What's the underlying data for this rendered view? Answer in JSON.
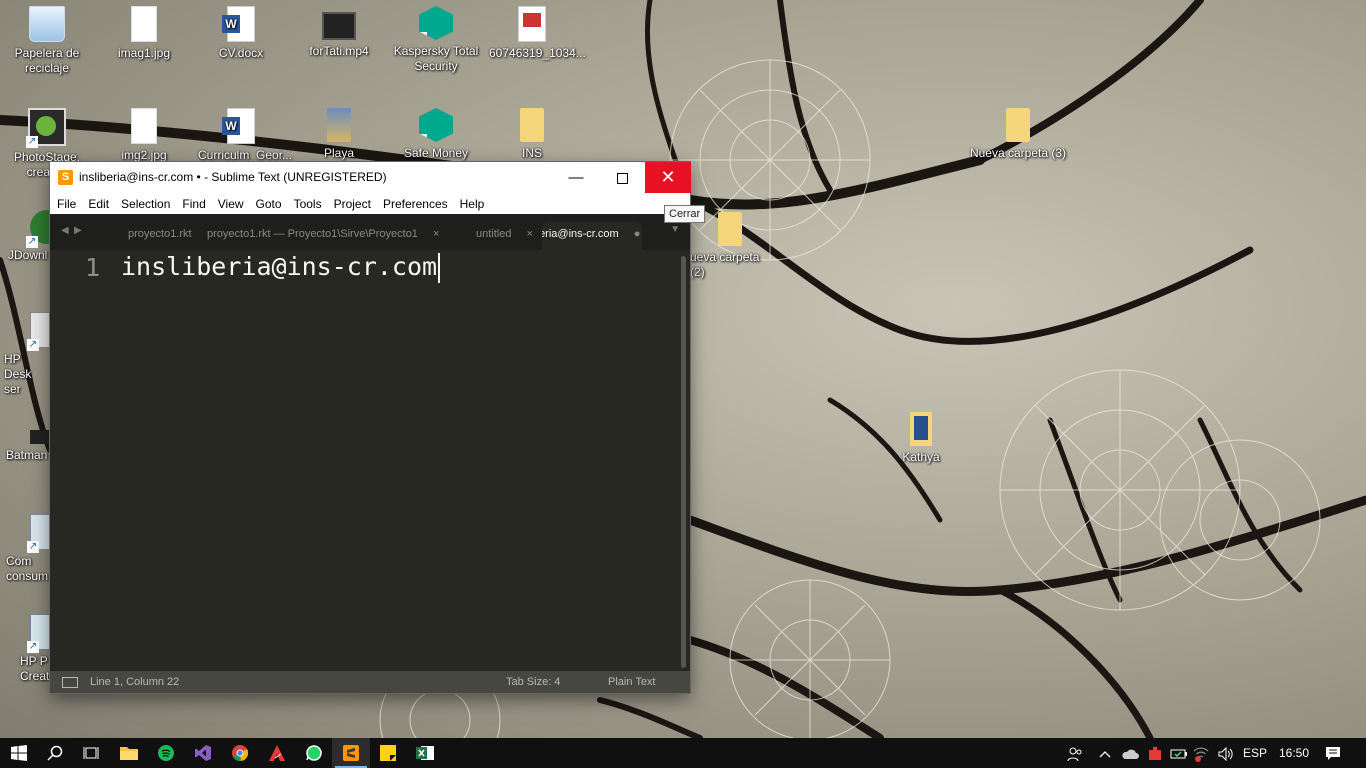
{
  "desktop": {
    "icons": [
      {
        "label": "Papelera de reciclaje"
      },
      {
        "label": "imag1.jpg"
      },
      {
        "label": "CV.docx"
      },
      {
        "label": "forTati.mp4"
      },
      {
        "label": "Kaspersky Total Security"
      },
      {
        "label": "60746319_1034..."
      },
      {
        "label": "PhotoStage, creador"
      },
      {
        "label": "img2.jpg"
      },
      {
        "label": "Curriculm_Geor..."
      },
      {
        "label": "Playa"
      },
      {
        "label": "Safe Money"
      },
      {
        "label": "INS"
      },
      {
        "label": "Nueva carpeta (3)"
      },
      {
        "label": "ueva carpeta (2)"
      },
      {
        "label": "JDownl"
      },
      {
        "label": "HP Desk ser"
      },
      {
        "label": "Batman"
      },
      {
        "label": "Com consum"
      },
      {
        "label": "HP P Creat"
      },
      {
        "label": "Kathya"
      }
    ]
  },
  "window": {
    "title": "insliberia@ins-cr.com • - Sublime Text (UNREGISTERED)",
    "app_icon_letter": "S",
    "close_glyph": "✕",
    "min_glyph": "—",
    "close_tooltip": "Cerrar"
  },
  "menu": [
    "File",
    "Edit",
    "Selection",
    "Find",
    "View",
    "Goto",
    "Tools",
    "Project",
    "Preferences",
    "Help"
  ],
  "tabs": [
    {
      "label": "proyecto1.rkt",
      "close": ""
    },
    {
      "label": "proyecto1.rkt — Proyecto1\\Sirve\\Proyecto1",
      "close": "×"
    },
    {
      "label": "untitled",
      "close": "×"
    },
    {
      "label": "insliberia@ins-cr.com",
      "close": "●"
    }
  ],
  "editor": {
    "line_number": "1",
    "text": "insliberia@ins-cr.com"
  },
  "status": {
    "position": "Line 1, Column 22",
    "tab_size": "Tab Size: 4",
    "syntax": "Plain Text"
  },
  "taskbar": {
    "language": "ESP",
    "time": "16:50"
  },
  "colors": {
    "accent_close": "#e81123",
    "editor_bg": "#272822",
    "taskbar_bg": "#101010"
  }
}
